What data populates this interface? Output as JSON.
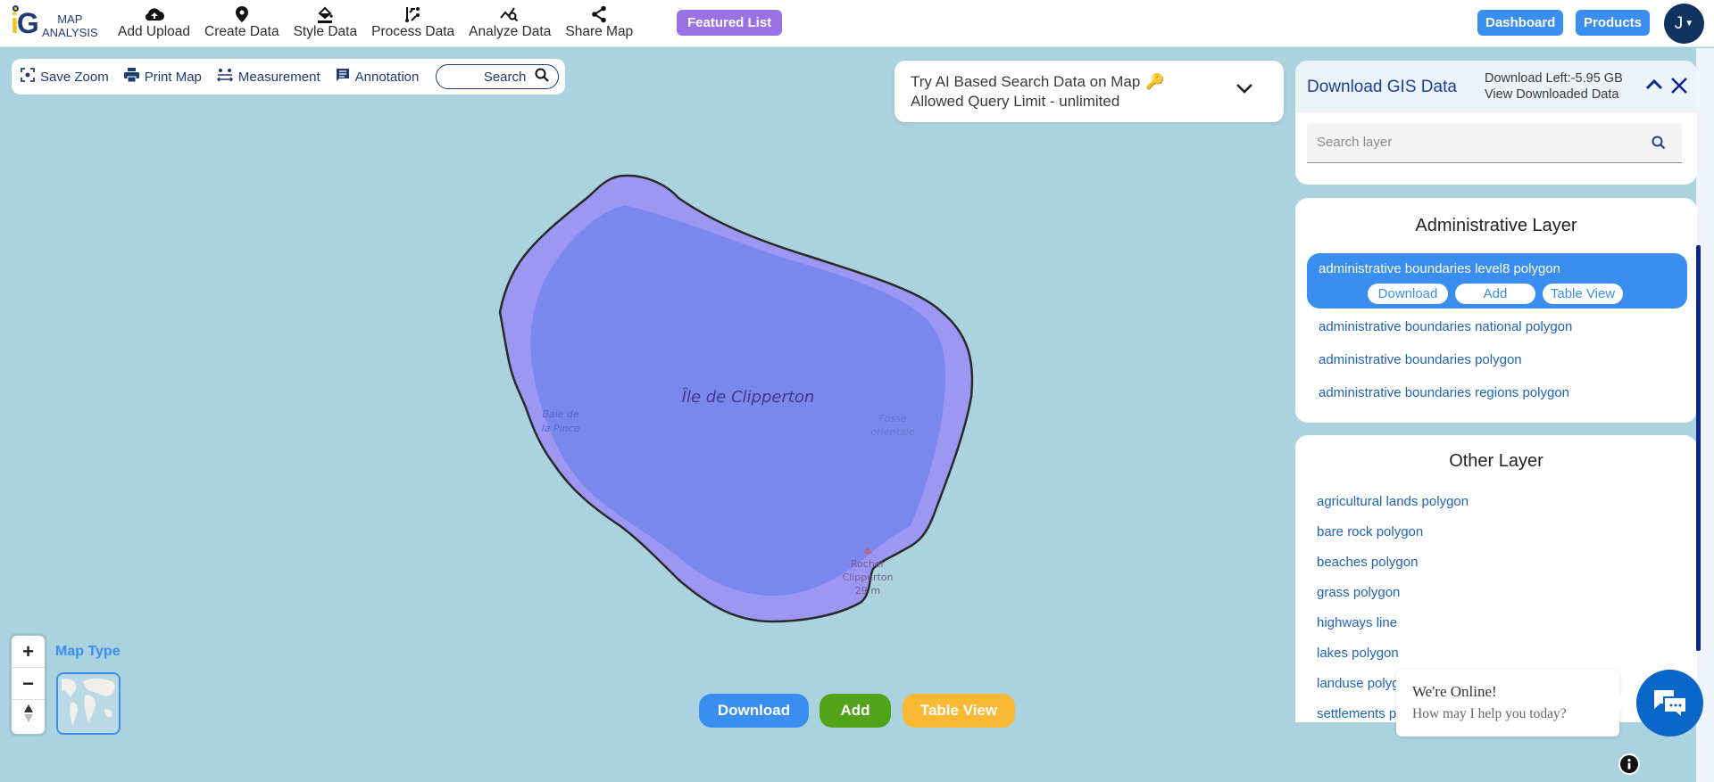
{
  "header": {
    "logo": {
      "mark": "iG",
      "line1": "MAP",
      "line2": "ANALYSIS"
    },
    "nav": [
      {
        "label": "Add Upload",
        "icon": "cloud-upload-icon"
      },
      {
        "label": "Create Data",
        "icon": "map-pin-icon"
      },
      {
        "label": "Style Data",
        "icon": "paint-bucket-icon"
      },
      {
        "label": "Process Data",
        "icon": "process-icon"
      },
      {
        "label": "Analyze Data",
        "icon": "analyze-icon"
      },
      {
        "label": "Share Map",
        "icon": "share-icon"
      }
    ],
    "featured_label": "Featured List",
    "dashboard_label": "Dashboard",
    "products_label": "Products",
    "avatar_initial": "J"
  },
  "toolbar": {
    "save_zoom": "Save Zoom",
    "print_map": "Print Map",
    "measurement": "Measurement",
    "annotation": "Annotation",
    "search": "Search"
  },
  "ai_search": {
    "line1": "Try AI Based Search Data on Map",
    "line2": "Allowed Query Limit - unlimited",
    "key_icon": "🔑"
  },
  "map": {
    "labels": {
      "island": "Île de Clipperton",
      "bay_1": "Baie de",
      "bay_2": "la Pince",
      "fosse_1": "Fosse",
      "fosse_2": "orientale",
      "rock_1": "Rocher",
      "rock_2": "Clipperton",
      "rock_3": "29 m"
    },
    "polygon_fill": "#8f8ff0",
    "lagoon_fill": "#7a88ee",
    "water": "#aad3df"
  },
  "panel": {
    "title": "Download GIS Data",
    "download_left": "Download Left:-5.95 GB",
    "view_downloaded": "View Downloaded Data",
    "search_placeholder": "Search layer",
    "admin": {
      "title": "Administrative Layer",
      "selected": {
        "name": "administrative boundaries level8 polygon",
        "download": "Download",
        "add": "Add",
        "table_view": "Table View"
      },
      "items": [
        "administrative boundaries national polygon",
        "administrative boundaries polygon",
        "administrative boundaries regions polygon"
      ]
    },
    "other": {
      "title": "Other Layer",
      "items": [
        "agricultural lands polygon",
        "bare rock polygon",
        "beaches polygon",
        "grass polygon",
        "highways line",
        "lakes polygon",
        "landuse polygon",
        "settlements polygon"
      ]
    }
  },
  "map_controls": {
    "zoom_in": "+",
    "zoom_out": "−",
    "map_type_label": "Map Type"
  },
  "bottom_actions": {
    "download": "Download",
    "add": "Add",
    "table_view": "Table View",
    "colors": {
      "download": "#3a8ef0",
      "add": "#52a319",
      "table_view": "#fbb834"
    }
  },
  "chat": {
    "title": "We're Online!",
    "subtitle": "How may I help you today?"
  }
}
